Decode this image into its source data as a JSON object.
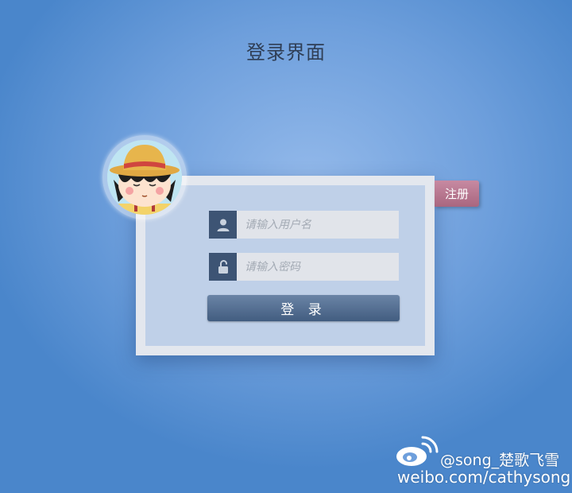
{
  "page": {
    "title": "登录界面"
  },
  "login": {
    "username_placeholder": "请输入用户名",
    "password_placeholder": "请输入密码",
    "submit_label": "登 录",
    "register_label": "注册",
    "username_icon": "user-icon",
    "password_icon": "unlock-icon"
  },
  "avatar": {
    "icon": "cartoon-girl-avatar"
  },
  "watermark": {
    "handle": "@song_楚歌飞雪",
    "url": "weibo.com/cathysong",
    "icon": "weibo-logo-icon"
  },
  "colors": {
    "field_icon_bg": "#3d5474",
    "login_button": "#4f6a8e",
    "register_button": "#b87590",
    "card_frame": "#e3e7ee",
    "card_inner": "#bfd0e8"
  }
}
